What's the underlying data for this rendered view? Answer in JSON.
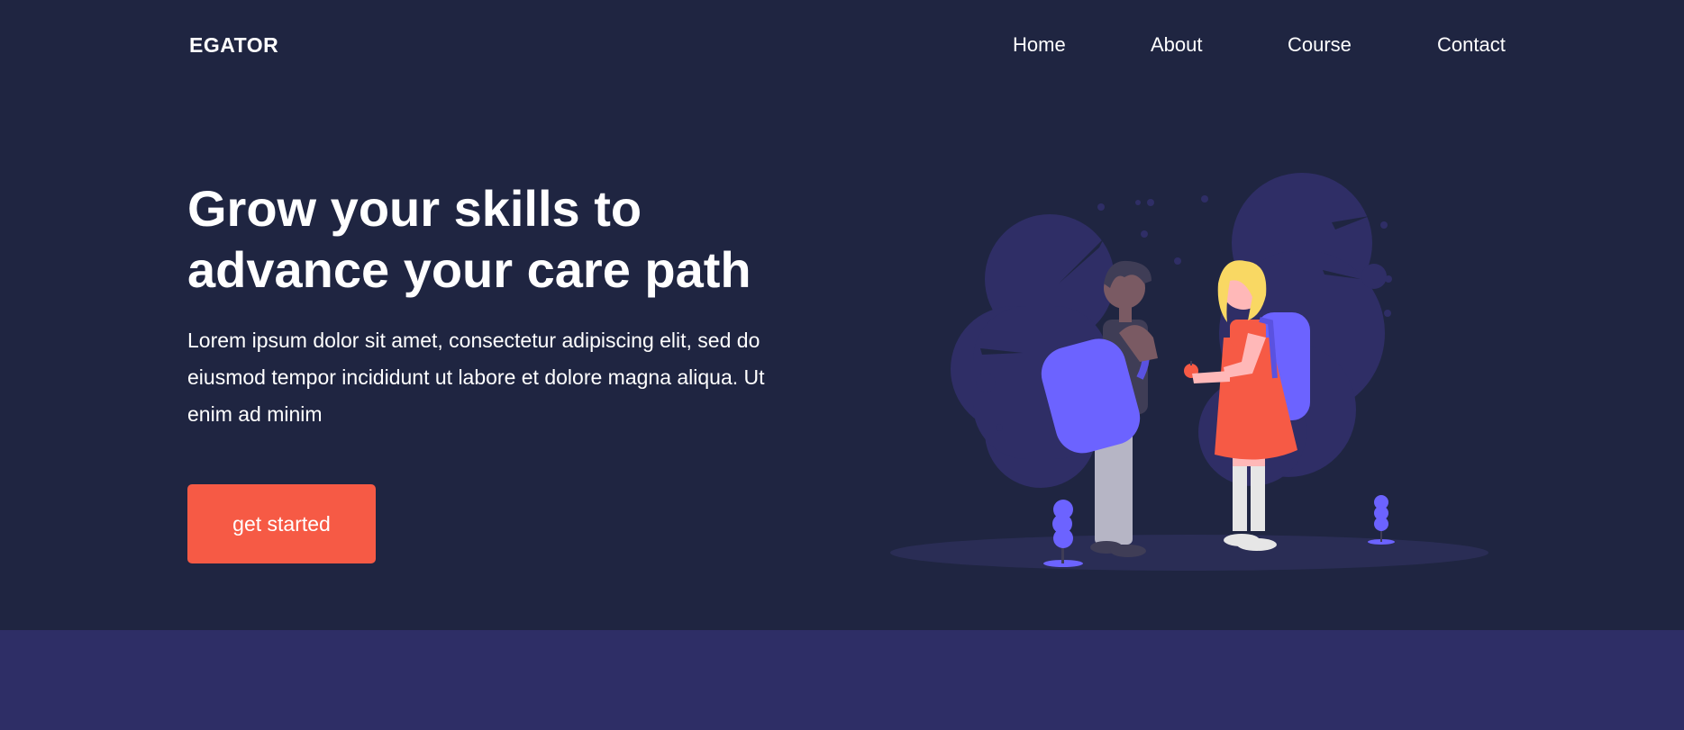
{
  "header": {
    "brand": "EGATOR",
    "nav": [
      "Home",
      "About",
      "Course",
      "Contact"
    ]
  },
  "hero": {
    "headline": "Grow your skills to advance your care path",
    "subtext": "Lorem ipsum dolor sit amet, consectetur adipiscing elit, sed do eiusmod tempor incididunt ut labore et dolore magna aliqua. Ut enim ad minim",
    "cta_label": "get started"
  },
  "colors": {
    "background": "#1f2541",
    "accent": "#f65a45",
    "illustration_purple": "#6c63ff",
    "blob": "#2f2e66",
    "band": "#2e2e66"
  }
}
